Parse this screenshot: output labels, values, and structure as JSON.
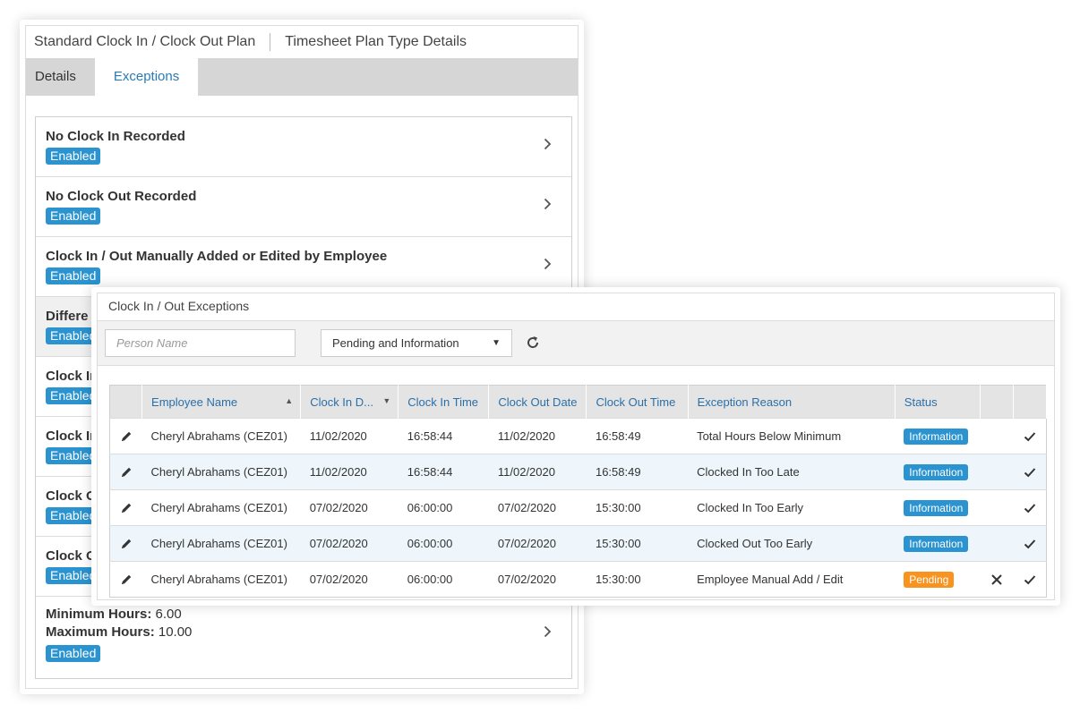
{
  "plan": {
    "title": "Standard Clock In / Clock Out Plan",
    "subtitle": "Timesheet Plan Type Details",
    "tabs": [
      {
        "label": "Details",
        "active": false
      },
      {
        "label": "Exceptions",
        "active": true
      }
    ],
    "exceptions": [
      {
        "title": "No Clock In Recorded",
        "status": "Enabled"
      },
      {
        "title": "No Clock Out Recorded",
        "status": "Enabled"
      },
      {
        "title": "Clock In / Out Manually Added or Edited by Employee",
        "status": "Enabled"
      },
      {
        "title": "Differe",
        "status": "Enabled"
      },
      {
        "title": "Clock In",
        "status": "Enabled"
      },
      {
        "title": "Clock In",
        "status": "Enabled"
      },
      {
        "title": "Clock O",
        "status": "Enabled"
      },
      {
        "title": "Clock O",
        "status": "Enabled"
      }
    ],
    "hours": {
      "min_label": "Minimum Hours:",
      "min_value": "6.00",
      "max_label": "Maximum Hours:",
      "max_value": "10.00",
      "status": "Enabled"
    }
  },
  "exceptions_panel": {
    "title": "Clock In / Out Exceptions",
    "search": {
      "placeholder": "Person Name",
      "value": ""
    },
    "filter": {
      "selected": "Pending and Information"
    },
    "columns": [
      "Employee Name",
      "Clock In D...",
      "Clock In Time",
      "Clock Out Date",
      "Clock Out Time",
      "Exception Reason",
      "Status"
    ],
    "rows": [
      {
        "employee": "Cheryl Abrahams (CEZ01)",
        "clock_in_date": "11/02/2020",
        "clock_in_time": "16:58:44",
        "clock_out_date": "11/02/2020",
        "clock_out_time": "16:58:49",
        "reason": "Total Hours Below Minimum",
        "status": "Information"
      },
      {
        "employee": "Cheryl Abrahams (CEZ01)",
        "clock_in_date": "11/02/2020",
        "clock_in_time": "16:58:44",
        "clock_out_date": "11/02/2020",
        "clock_out_time": "16:58:49",
        "reason": "Clocked In Too Late",
        "status": "Information"
      },
      {
        "employee": "Cheryl Abrahams (CEZ01)",
        "clock_in_date": "07/02/2020",
        "clock_in_time": "06:00:00",
        "clock_out_date": "07/02/2020",
        "clock_out_time": "15:30:00",
        "reason": "Clocked In Too Early",
        "status": "Information"
      },
      {
        "employee": "Cheryl Abrahams (CEZ01)",
        "clock_in_date": "07/02/2020",
        "clock_in_time": "06:00:00",
        "clock_out_date": "07/02/2020",
        "clock_out_time": "15:30:00",
        "reason": "Clocked Out Too Early",
        "status": "Information"
      },
      {
        "employee": "Cheryl Abrahams (CEZ01)",
        "clock_in_date": "07/02/2020",
        "clock_in_time": "06:00:00",
        "clock_out_date": "07/02/2020",
        "clock_out_time": "15:30:00",
        "reason": "Employee Manual Add / Edit",
        "status": "Pending"
      }
    ]
  },
  "colors": {
    "accent": "#2a7ab5",
    "badge_blue": "#2a93d0",
    "badge_orange": "#f7931e",
    "tab_bar": "#d6d6d6",
    "alt_row": "#eef6fb"
  }
}
